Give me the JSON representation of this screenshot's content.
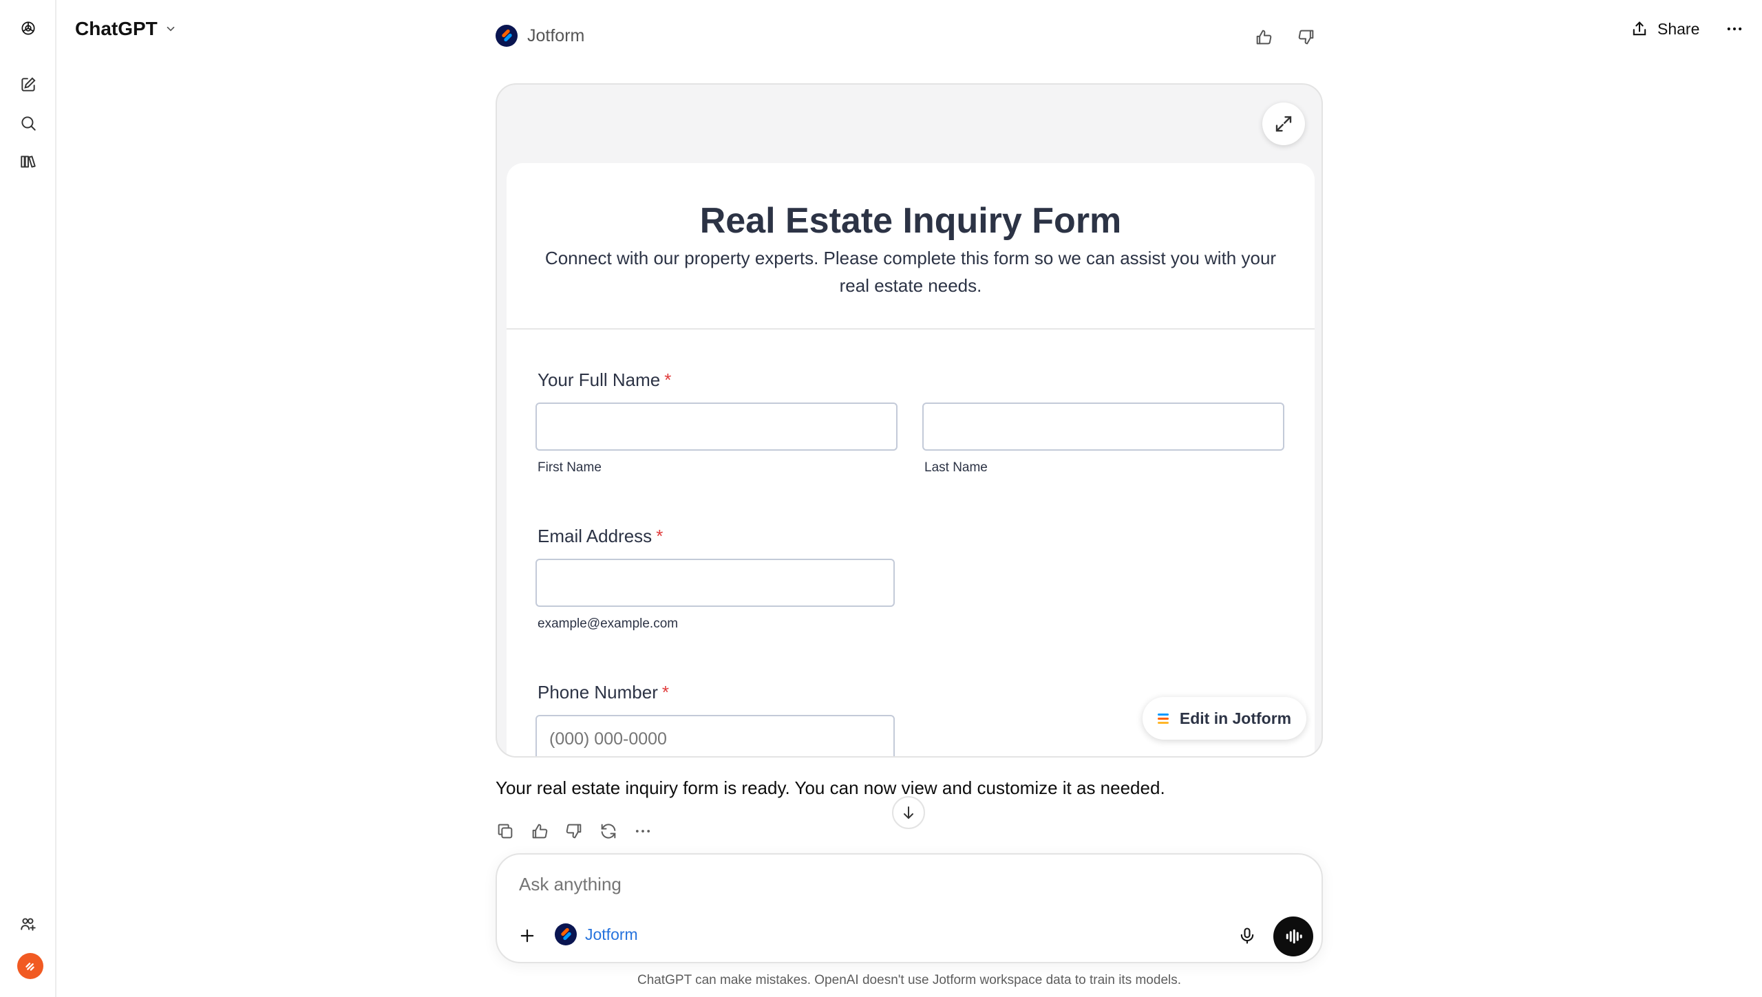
{
  "app": {
    "title": "ChatGPT",
    "share_label": "Share"
  },
  "conversation_app": {
    "name": "Jotform"
  },
  "form": {
    "title": "Real Estate Inquiry Form",
    "description": "Connect with our property experts. Please complete this form so we can assist you with your real estate needs.",
    "required_marker": "*",
    "full_name": {
      "label": "Your Full Name",
      "first_sublabel": "First Name",
      "last_sublabel": "Last Name",
      "first_value": "",
      "last_value": ""
    },
    "email": {
      "label": "Email Address",
      "sublabel": "example@example.com",
      "value": ""
    },
    "phone": {
      "label": "Phone Number",
      "placeholder": "(000) 000-0000"
    },
    "edit_button_label": "Edit in Jotform"
  },
  "message": {
    "text": "Your real estate inquiry form is ready. You can now view and customize it as needed."
  },
  "composer": {
    "placeholder": "Ask anything",
    "tool_label": "Jotform"
  },
  "footer": {
    "disclaimer": "ChatGPT can make mistakes. OpenAI doesn't use Jotform workspace data to train its models."
  },
  "colors": {
    "required": "#e03c3c",
    "tool_link": "#2673dd",
    "form_text": "#2c3345",
    "avatar": "#f15a22"
  }
}
